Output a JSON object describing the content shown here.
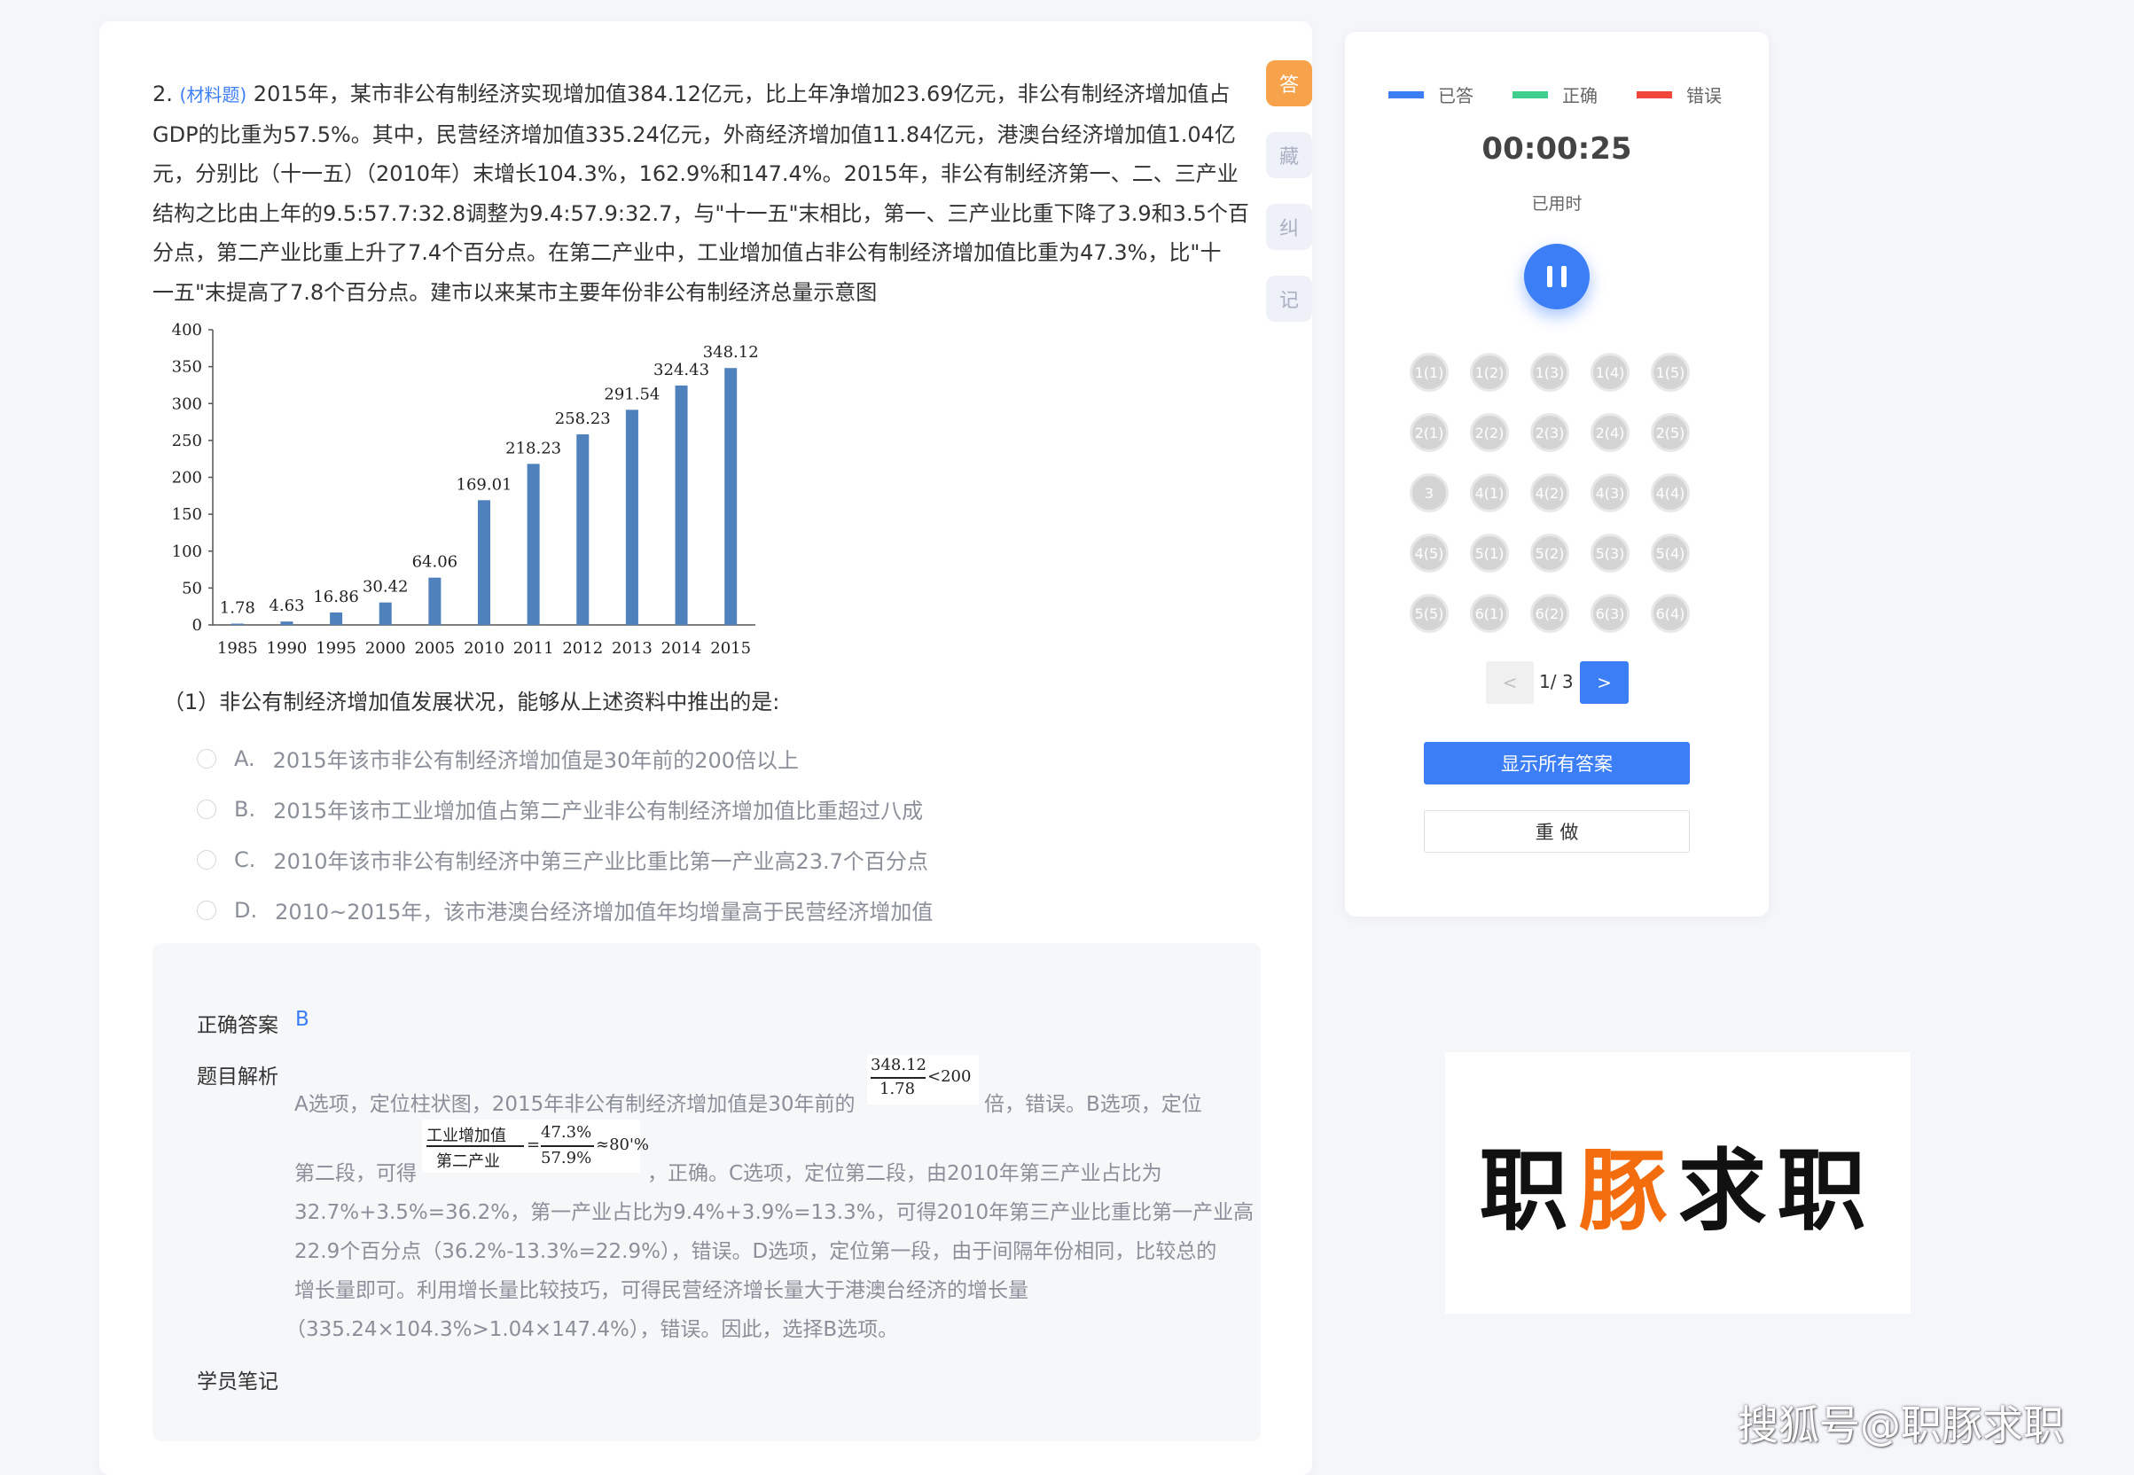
{
  "question": {
    "number": "2.",
    "tag": "(材料题)",
    "lines": [
      "2015年，某市非公有制经济实现增加值384.12亿元，比上年净增加23.69亿元，非公有制经济增加值占",
      "GDP的比重为57.5%。其中，民营经济增加值335.24亿元，外商经济增加值11.84亿元，港澳台经济增加值1.04亿",
      "元，分别比（十一五）（2010年）末增长104.3%，162.9%和147.4%。2015年，非公有制经济第一、二、三产业",
      "结构之比由上年的9.5:57.7:32.8调整为9.4:57.9:32.7，与\"十一五\"末相比，第一、三产业比重下降了3.9和3.5个百",
      "分点，第二产业比重上升了7.4个百分点。在第二产业中，工业增加值占非公有制经济增加值比重为47.3%，比\"十",
      "一五\"末提高了7.8个百分点。建市以来某市主要年份非公有制经济总量示意图"
    ]
  },
  "side_tabs": [
    "答",
    "藏",
    "纠",
    "记"
  ],
  "chart_data": {
    "type": "bar",
    "categories": [
      "1985",
      "1990",
      "1995",
      "2000",
      "2005",
      "2010",
      "2011",
      "2012",
      "2013",
      "2014",
      "2015"
    ],
    "values": [
      1.78,
      4.63,
      16.86,
      30.42,
      64.06,
      169.01,
      218.23,
      258.23,
      291.54,
      324.43,
      348.12
    ],
    "ylim": [
      0,
      400
    ],
    "yticks": [
      "0",
      "50",
      "100",
      "150",
      "200",
      "250",
      "300",
      "350",
      "400"
    ],
    "bar_color": "#4f81bd"
  },
  "sub_question": "（1）非公有制经济增加值发展状况，能够从上述资料中推出的是:",
  "options": [
    {
      "letter": "A.",
      "text": "2015年该市非公有制经济增加值是30年前的200倍以上"
    },
    {
      "letter": "B.",
      "text": "2015年该市工业增加值占第二产业非公有制经济增加值比重超过八成"
    },
    {
      "letter": "C.",
      "text": "2010年该市非公有制经济中第三产业比重比第一产业高23.7个百分点"
    },
    {
      "letter": "D.",
      "text": "2010~2015年，该市港澳台经济增加值年均增量高于民营经济增加值"
    }
  ],
  "answer": {
    "correct_label": "正确答案",
    "correct_value": "B",
    "analysis_label": "题目解析",
    "notes_label": "学员笔记",
    "line1_a": "A选项，定位柱状图，2015年非公有制经济增加值是30年前的",
    "line1_b": "倍，错误。B选项，定位",
    "line2_a": "第二段，可得",
    "line2_b": "，正确。C选项，定位第二段，由2010年第三产业占比为",
    "line3": "32.7%+3.5%=36.2%，第一产业占比为9.4%+3.9%=13.3%，可得2010年第三产业比重比第一产业高",
    "line4": "22.9个百分点（36.2%-13.3%=22.9%），错误。D选项，定位第一段，由于间隔年份相同，比较总的",
    "line5": "增长量即可。利用增长量比较技巧，可得民营经济增长量大于港澳台经济的增长量",
    "line6": "（335.24×104.3%>1.04×147.4%），错误。因此，选择B选项。",
    "frac1": {
      "num": "348.12",
      "den": "1.78",
      "rest": "<200"
    },
    "frac2": {
      "num1": "工业增加值",
      "den1": "第二产业",
      "num2": "47.3%",
      "den2": "57.9%",
      "rest": "≈80'%"
    }
  },
  "panel": {
    "legend": [
      {
        "label": "已答",
        "color": "#3b7ef5"
      },
      {
        "label": "正确",
        "color": "#3ecf8e"
      },
      {
        "label": "错误",
        "color": "#f0463c"
      }
    ],
    "timer": "00:00:25",
    "timer_label": "已用时",
    "qnums": [
      "1(1)",
      "1(2)",
      "1(3)",
      "1(4)",
      "1(5)",
      "2(1)",
      "2(2)",
      "2(3)",
      "2(4)",
      "2(5)",
      "3",
      "4(1)",
      "4(2)",
      "4(3)",
      "4(4)",
      "4(5)",
      "5(1)",
      "5(2)",
      "5(3)",
      "5(4)",
      "5(5)",
      "6(1)",
      "6(2)",
      "6(3)",
      "6(4)"
    ],
    "pager": {
      "prev": "<",
      "text": "1/ 3",
      "next": ">"
    },
    "show_answers": "显示所有答案",
    "redo": "重 做"
  },
  "logo": {
    "part1": "职",
    "part2": "豚",
    "part3": "求职"
  },
  "watermark": "搜狐号@职豚求职"
}
